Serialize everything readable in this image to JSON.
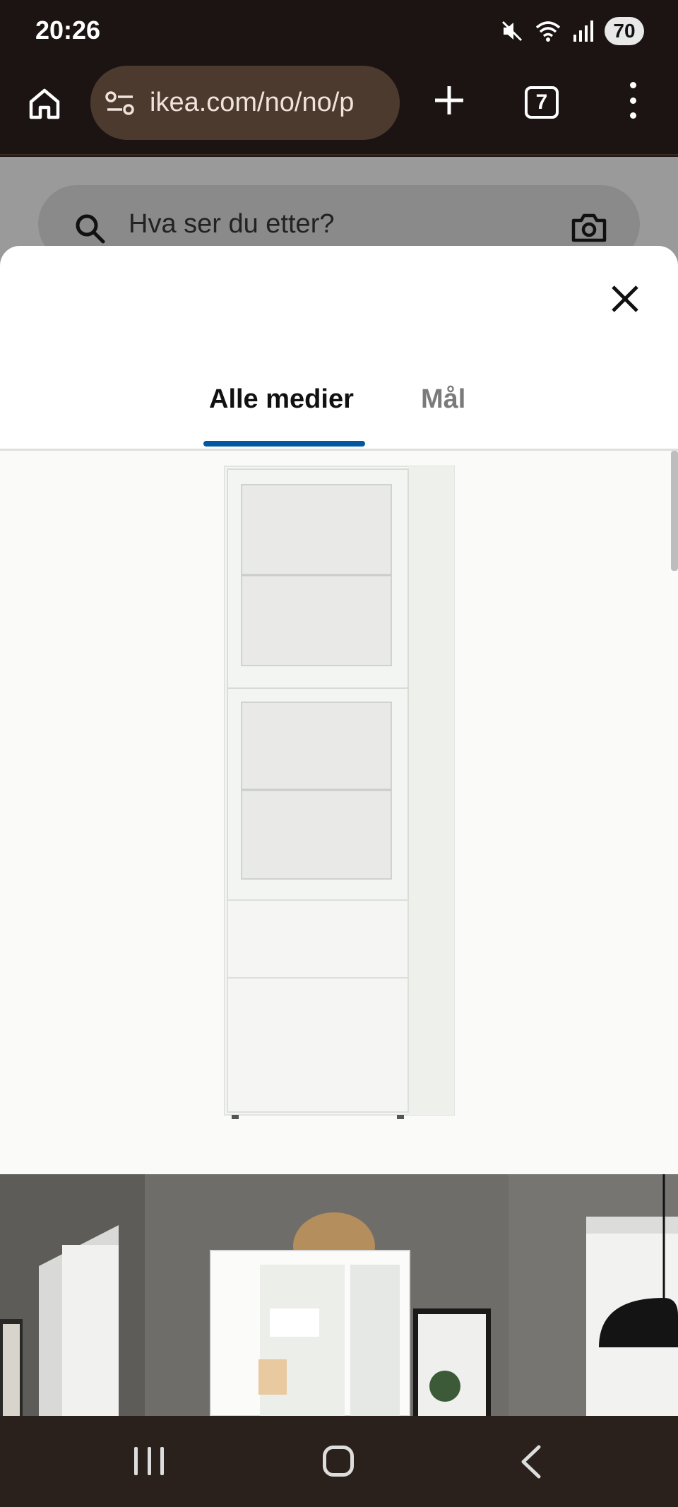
{
  "status_bar": {
    "time": "20:26",
    "battery": "70",
    "icons": [
      "mute-icon",
      "wifi-icon",
      "signal-icon"
    ]
  },
  "browser": {
    "url": "ikea.com/no/no/p",
    "tab_count": "7",
    "icons": [
      "home-icon",
      "site-settings-icon",
      "plus-icon",
      "menu-icon"
    ]
  },
  "page": {
    "search_placeholder": "Hva ser du etter?"
  },
  "modal": {
    "tabs": [
      {
        "label": "Alle medier",
        "selected": true
      },
      {
        "label": "Mål",
        "selected": false
      }
    ],
    "accent_color": "#0058a3"
  },
  "nav": {
    "icons": [
      "recents-icon",
      "home-icon",
      "back-icon"
    ]
  }
}
